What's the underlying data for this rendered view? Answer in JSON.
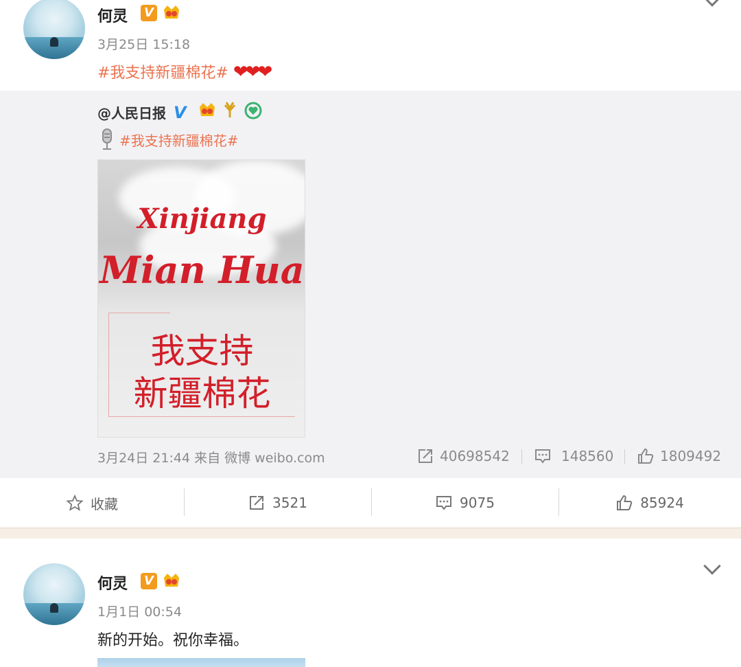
{
  "post1": {
    "user": "何灵",
    "vip_badge": "V",
    "time": "3月25日 15:18",
    "text_tag": "#我支持新疆棉花#",
    "hearts": "❤❤❤"
  },
  "repost": {
    "user": "@人民日报",
    "verified_badge": "V",
    "tag": "#我支持新疆棉花#",
    "image": {
      "line1": "Xinjiang",
      "line2": "Mian Hua",
      "cn_line1": "我支持",
      "cn_line2": "新疆棉花"
    },
    "meta": "3月24日 21:44 来自 微博 weibo.com",
    "reposts": "40698542",
    "comments": "148560",
    "likes": "1809492"
  },
  "actions": {
    "favorite": "收藏",
    "reposts": "3521",
    "comments": "9075",
    "likes": "85924"
  },
  "post2": {
    "user": "何灵",
    "vip_badge": "V",
    "time": "1月1日 00:54",
    "text": "新的开始。祝你幸福。"
  },
  "colors": {
    "tag": "#eb7350",
    "verified_blue": "#2a8ee8",
    "vip_orange": "#f29b1e",
    "image_red": "#d21f2a"
  }
}
